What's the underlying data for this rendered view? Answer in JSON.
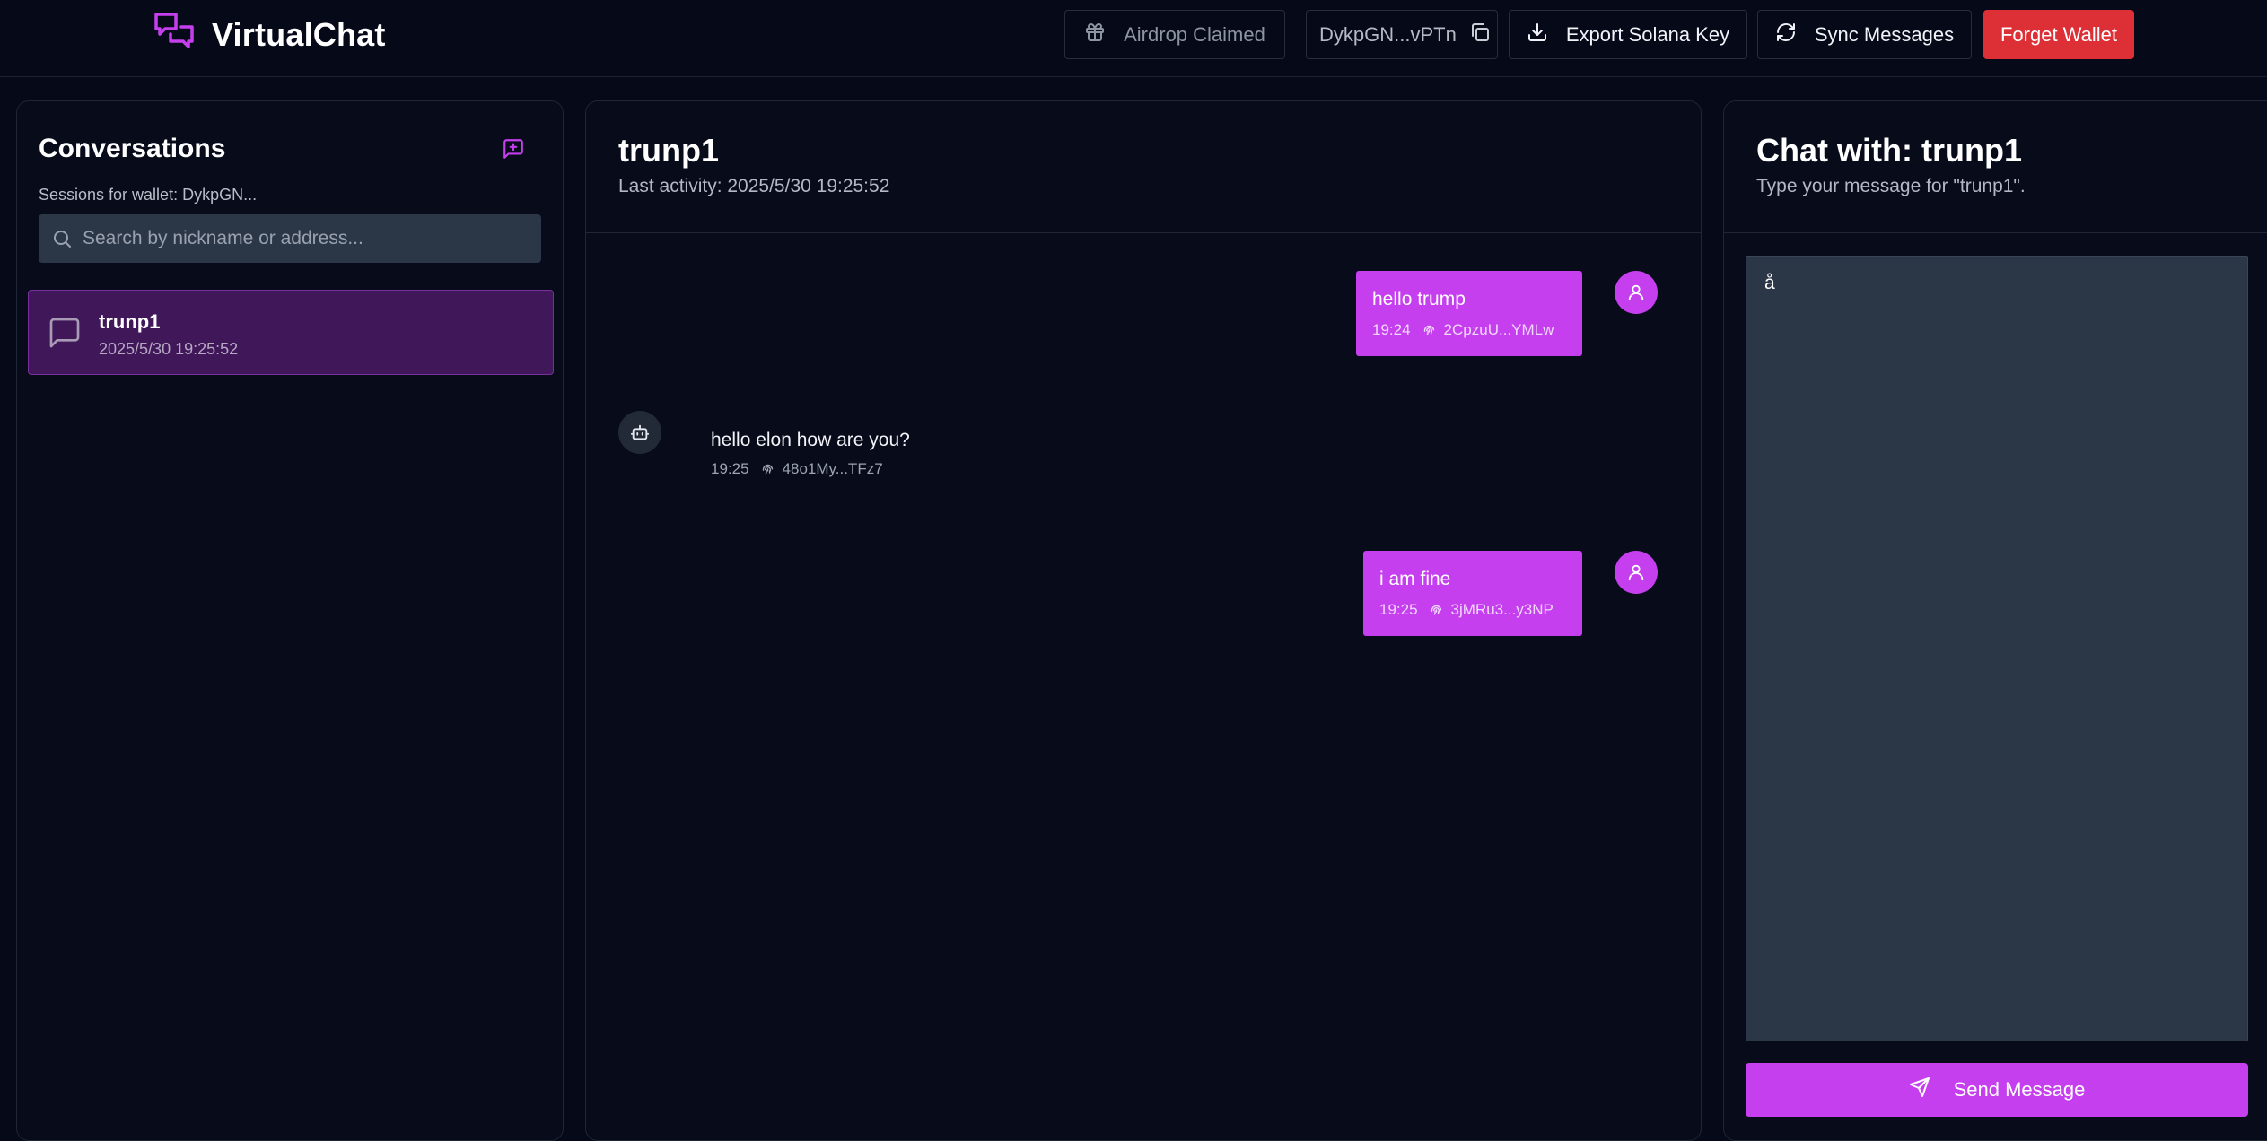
{
  "app": {
    "name": "VirtualChat"
  },
  "topbar": {
    "airdrop_label": "Airdrop Claimed",
    "wallet_address": "DykpGN...vPTn",
    "export_label": "Export Solana Key",
    "sync_label": "Sync Messages",
    "forget_label": "Forget Wallet"
  },
  "sidebar": {
    "title": "Conversations",
    "sessions_label": "Sessions for wallet: DykpGN...",
    "search_placeholder": "Search by nickname or address...",
    "conversations": [
      {
        "name": "trunp1",
        "time": "2025/5/30 19:25:52"
      }
    ]
  },
  "chat": {
    "title": "trunp1",
    "last_activity": "Last activity: 2025/5/30 19:25:52",
    "messages": [
      {
        "side": "outgoing",
        "text": "hello trump",
        "time": "19:24",
        "sig": "2CpzuU...YMLw"
      },
      {
        "side": "incoming",
        "text": "hello elon how are you?",
        "time": "19:25",
        "sig": "48o1My...TFz7"
      },
      {
        "side": "outgoing",
        "text": "i am fine",
        "time": "19:25",
        "sig": "3jMRu3...y3NP"
      }
    ]
  },
  "composer": {
    "title": "Chat with: trunp1",
    "subtitle": "Type your message for \"trunp1\".",
    "value": "å",
    "send_label": "Send Message"
  },
  "colors": {
    "accent": "#c53fef",
    "danger": "#dc2f36",
    "background": "#060a18",
    "input_bg": "#2b3647",
    "selected_bg": "#40185a"
  },
  "icons": {
    "logo": "chat-bubbles-icon",
    "airdrop": "gift-icon",
    "copy": "copy-icon",
    "export": "download-icon",
    "sync": "refresh-icon",
    "new_chat": "message-plus-icon",
    "search": "search-icon",
    "conversation": "message-square-icon",
    "user": "user-icon",
    "bot": "bot-icon",
    "signature": "fingerprint-icon",
    "send": "send-icon"
  }
}
